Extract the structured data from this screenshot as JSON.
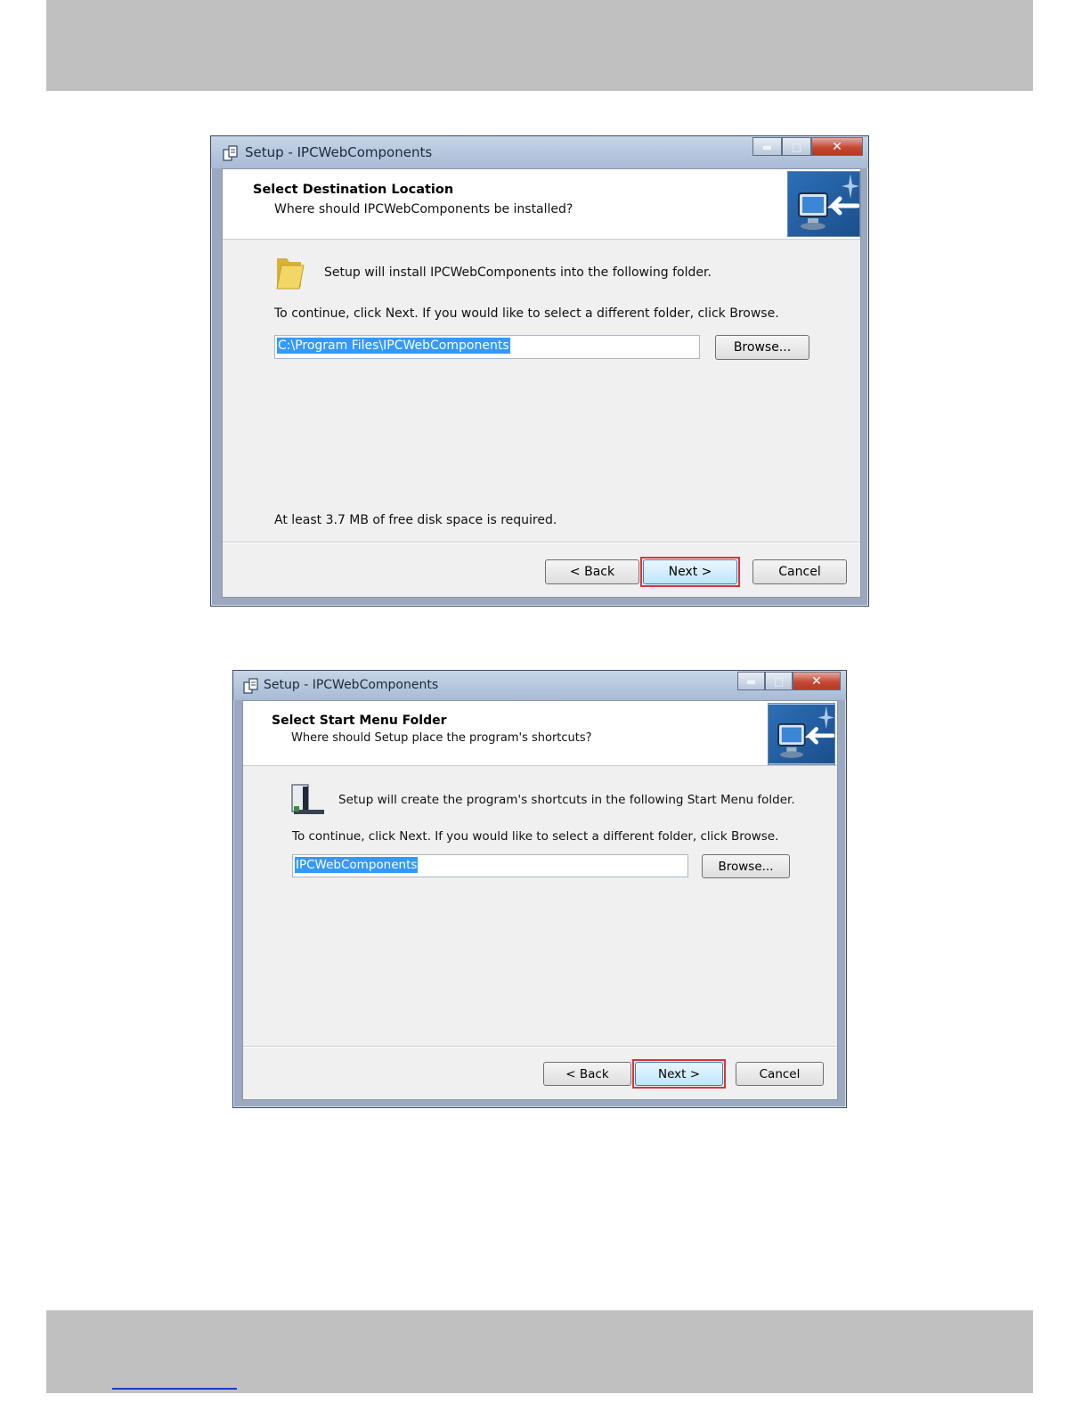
{
  "dialog1": {
    "window_title": "Setup - IPCWebComponents",
    "heading": "Select Destination Location",
    "subheading": "Where should IPCWebComponents be installed?",
    "info_text": "Setup will install IPCWebComponents into the following folder.",
    "instruction": "To continue, click Next. If you would like to select a different folder, click Browse.",
    "path_value": "C:\\Program Files\\IPCWebComponents",
    "browse_label": "Browse...",
    "disk_space": "At least 3.7 MB of free disk space is required.",
    "back_label": "< Back",
    "next_label": "Next >",
    "cancel_label": "Cancel"
  },
  "dialog2": {
    "window_title": "Setup - IPCWebComponents",
    "heading": "Select Start Menu Folder",
    "subheading": "Where should Setup place the program's shortcuts?",
    "info_text": "Setup will create the program's shortcuts in the following Start Menu folder.",
    "instruction": "To continue, click Next. If you would like to select a different folder, click Browse.",
    "folder_value": "IPCWebComponents",
    "browse_label": "Browse...",
    "back_label": "< Back",
    "next_label": "Next >",
    "cancel_label": "Cancel"
  },
  "icons": [
    "setup-app-icon",
    "minimize-icon",
    "maximize-icon",
    "close-icon",
    "wizard-computer-icon",
    "folder-icon",
    "start-menu-folder-icon"
  ],
  "colors": {
    "highlight": "#e0303a",
    "selection": "#3399ff",
    "band": "#c0c0c0"
  }
}
